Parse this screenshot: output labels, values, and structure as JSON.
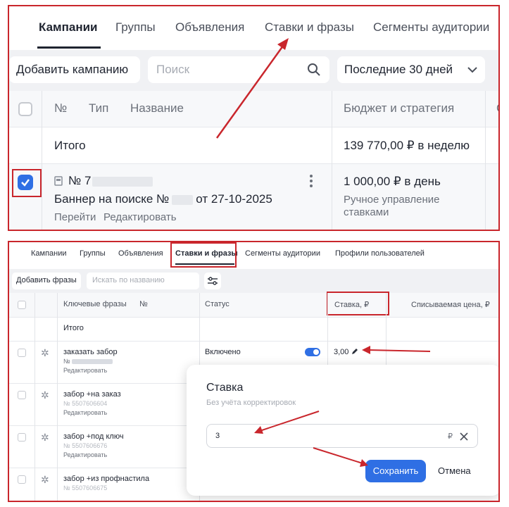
{
  "top_panel": {
    "tabs": [
      {
        "label": "Кампании",
        "active": true
      },
      {
        "label": "Группы"
      },
      {
        "label": "Объявления"
      },
      {
        "label": "Ставки и фразы"
      },
      {
        "label": "Сегменты аудитории"
      }
    ],
    "add_button": "Добавить кампанию",
    "search_placeholder": "Поиск",
    "period": "Последние 30 дней",
    "columns": {
      "number": "№",
      "type": "Тип",
      "name": "Название",
      "budget": "Бюджет и стратегия",
      "next": "С"
    },
    "total_label": "Итого",
    "total_budget": "139 770,00 ₽ в неделю",
    "campaign": {
      "number_label": "№ 7",
      "title_prefix": "Баннер на поиске №",
      "title_suffix": "от 27-10-2025",
      "link_go": "Перейти",
      "link_edit": "Редактировать",
      "budget": "1 000,00 ₽ в день",
      "strategy": "Ручное управление ставками",
      "checked": true
    }
  },
  "bottom_panel": {
    "tabs": [
      {
        "label": "Кампании"
      },
      {
        "label": "Группы"
      },
      {
        "label": "Объявления"
      },
      {
        "label": "Ставки и фразы",
        "active": true
      },
      {
        "label": "Сегменты аудитории"
      },
      {
        "label": "Профили пользователей"
      }
    ],
    "add_button": "Добавить фразы",
    "search_placeholder": "Искать по названию",
    "columns": {
      "phrases": "Ключевые фразы",
      "number": "№",
      "status": "Статус",
      "bid": "Ставка, ₽",
      "charged": "Списываемая цена, ₽"
    },
    "total_label": "Итого",
    "rows": [
      {
        "phrase": "заказать забор",
        "number": "№",
        "edit": "Редактировать",
        "status": "Включено",
        "bid": "3,00"
      },
      {
        "phrase": "забор +на заказ",
        "number": "№ 5507606604",
        "edit": "Редактировать"
      },
      {
        "phrase": "забор +под ключ",
        "number": "№ 5507606676",
        "edit": "Редактировать"
      },
      {
        "phrase": "забор +из профнастила",
        "number": "№ 5507606675",
        "edit": "Редактировать"
      }
    ],
    "popup": {
      "title": "Ставка",
      "subtitle": "Без учёта корректировок",
      "value": "3",
      "currency": "₽",
      "save": "Сохранить",
      "cancel": "Отмена"
    }
  },
  "colors": {
    "annotation": "#c9262c",
    "accent": "#2f6fe4"
  }
}
